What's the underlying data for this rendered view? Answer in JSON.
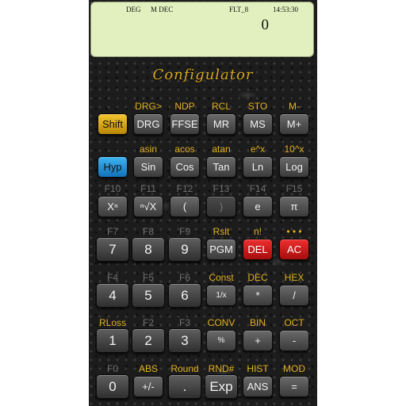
{
  "display": {
    "angle_mode": "DEG",
    "memory_mode": "M DEC",
    "float_mode": "FLT_8",
    "time": "14:53:30",
    "value": "0"
  },
  "title": "Configulator",
  "rows": [
    [
      {
        "label": "",
        "key": "Shift",
        "style": "gold"
      },
      {
        "label": "DRG>",
        "key": "DRG"
      },
      {
        "label": "NDP",
        "key": "FFSE"
      },
      {
        "label": "RCL",
        "key": "MR"
      },
      {
        "label": "STO",
        "key": "MS"
      },
      {
        "label": "M-",
        "key": "M+"
      }
    ],
    [
      {
        "label": "",
        "key": "Hyp",
        "style": "blue"
      },
      {
        "label": "asin",
        "key": "Sin"
      },
      {
        "label": "acos",
        "key": "Cos"
      },
      {
        "label": "atan",
        "key": "Tan"
      },
      {
        "label": "e^x",
        "key": "Ln"
      },
      {
        "label": "10^x",
        "key": "Log"
      }
    ],
    [
      {
        "label": "F10",
        "key": "Xⁿ",
        "label_style": "gray"
      },
      {
        "label": "F11",
        "key": "ⁿ√X",
        "label_style": "gray"
      },
      {
        "label": "F12",
        "key": "(",
        "label_style": "gray"
      },
      {
        "label": "F13",
        "key": ")",
        "label_style": "gray",
        "style": "disabled"
      },
      {
        "label": "F14",
        "key": "e",
        "label_style": "gray"
      },
      {
        "label": "F15",
        "key": "π",
        "label_style": "gray"
      }
    ],
    [
      {
        "label": "F7",
        "key": "7",
        "label_style": "gray",
        "style": "big"
      },
      {
        "label": "F8",
        "key": "8",
        "label_style": "gray",
        "style": "big"
      },
      {
        "label": "F9",
        "key": "9",
        "label_style": "gray",
        "style": "big"
      },
      {
        "label": "Rslt",
        "key": "PGM"
      },
      {
        "label": "n!",
        "key": "DEL",
        "style": "red"
      },
      {
        "label": "• • •",
        "key": "AC",
        "style": "red"
      }
    ],
    [
      {
        "label": "F4",
        "key": "4",
        "label_style": "gray",
        "style": "big"
      },
      {
        "label": "F5",
        "key": "5",
        "label_style": "gray",
        "style": "big"
      },
      {
        "label": "F6",
        "key": "6",
        "label_style": "gray",
        "style": "big"
      },
      {
        "label": "Const",
        "key": "1/x",
        "style": "small"
      },
      {
        "label": "DEC",
        "key": "*"
      },
      {
        "label": "HEX",
        "key": "/"
      }
    ],
    [
      {
        "label": "RLoss",
        "key": "1",
        "style": "big"
      },
      {
        "label": "F2",
        "key": "2",
        "label_style": "gray",
        "style": "big"
      },
      {
        "label": "F3",
        "key": "3",
        "label_style": "gray",
        "style": "big"
      },
      {
        "label": "CONV",
        "key": "%",
        "style": "small"
      },
      {
        "label": "BIN",
        "key": "+"
      },
      {
        "label": "OCT",
        "key": "-"
      }
    ],
    [
      {
        "label": "F0",
        "key": "0",
        "label_style": "gray",
        "style": "big"
      },
      {
        "label": "ABS",
        "key": "+/-"
      },
      {
        "label": "Round",
        "key": ".",
        "style": "big"
      },
      {
        "label": "RND#",
        "key": "Exp",
        "style": "big"
      },
      {
        "label": "HIST",
        "key": "ANS"
      },
      {
        "label": "MOD",
        "key": "="
      }
    ]
  ]
}
